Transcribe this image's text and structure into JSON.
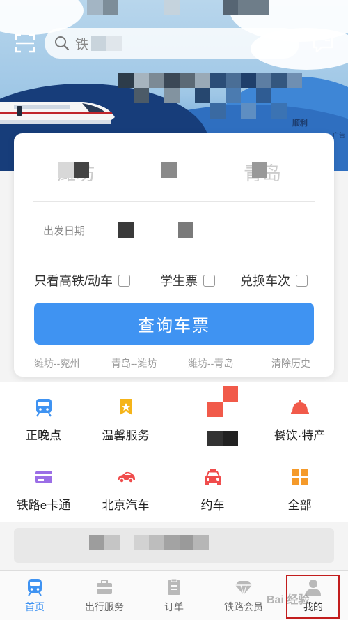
{
  "search": {
    "placeholder": "铁"
  },
  "banner": {
    "ad_label": "广告",
    "ad_sub": "顺利"
  },
  "ticket": {
    "from_station": "潍坊",
    "to_station": "青岛",
    "date_label": "出发日期",
    "date_value": "",
    "options": [
      {
        "label": "只看高铁/动车",
        "checked": false
      },
      {
        "label": "学生票",
        "checked": false
      },
      {
        "label": "兑换车次",
        "checked": false
      }
    ],
    "query_button": "查询车票",
    "history": [
      "潍坊--兖州",
      "青岛--潍坊",
      "潍坊--青岛"
    ],
    "clear_history": "清除历史"
  },
  "services": [
    {
      "label": "正晚点",
      "icon": "train-schedule-icon",
      "color": "#3f93f2"
    },
    {
      "label": "温馨服务",
      "icon": "service-badge-icon",
      "color": "#f5b419"
    },
    {
      "label": "",
      "icon": "redacted-icon",
      "color": "#f15a4a"
    },
    {
      "label": "餐饮·特产",
      "icon": "dining-cloche-icon",
      "color": "#f15a4a"
    },
    {
      "label": "铁路e卡通",
      "icon": "e-card-icon",
      "color": "#9b6ee6"
    },
    {
      "label": "北京汽车",
      "icon": "car-icon",
      "color": "#f04c4c"
    },
    {
      "label": "约车",
      "icon": "taxi-icon",
      "color": "#f04c4c"
    },
    {
      "label": "全部",
      "icon": "grid-all-icon",
      "color": "#f59a2a"
    }
  ],
  "tabs": [
    {
      "label": "首页",
      "icon": "home-train-icon",
      "active": true
    },
    {
      "label": "出行服务",
      "icon": "briefcase-icon",
      "active": false
    },
    {
      "label": "订单",
      "icon": "order-clipboard-icon",
      "active": false
    },
    {
      "label": "铁路会员",
      "icon": "diamond-icon",
      "active": false
    },
    {
      "label": "我的",
      "icon": "user-icon",
      "active": false
    }
  ],
  "watermark": "Bai 经验",
  "colors": {
    "accent": "#3f93f2",
    "highlight": "#c21d1d"
  }
}
